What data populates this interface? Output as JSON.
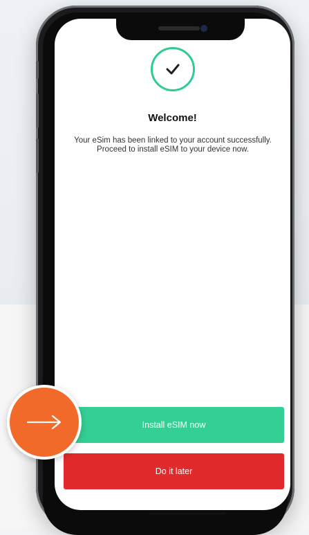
{
  "screen": {
    "welcome_title": "Welcome!",
    "message": "Your eSim has been linked to your account successfully. Proceed to install eSIM to your device now.",
    "success_icon": "check-circle-icon"
  },
  "actions": {
    "install_label": "Install eSIM now",
    "later_label": "Do it later"
  },
  "overlay": {
    "icon": "arrow-right-icon"
  },
  "colors": {
    "accent_green": "#34cf95",
    "check_green": "#2ecc8f",
    "danger_red": "#e12a2b",
    "overlay_orange": "#f26a2a"
  }
}
